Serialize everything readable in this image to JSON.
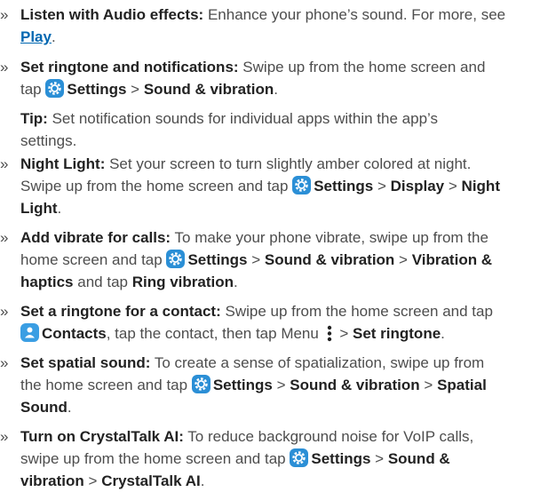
{
  "icons": {
    "settings": "settings-gear-icon",
    "contacts": "contacts-person-icon",
    "menu": "menu-dots-icon"
  },
  "colors": {
    "text": "#4d4d4d",
    "bold": "#222222",
    "link": "#0067b1",
    "icon_bg": "#2b8fd6"
  },
  "items": [
    {
      "head": "Listen with Audio effects:",
      "l1": "Enhance your phone’s sound. For more, see",
      "link": "Play",
      "l2": "."
    },
    {
      "head": "Set ringtone and notifications:",
      "l1": "Swipe up from the home screen and",
      "l2a": "tap",
      "settings": "Settings",
      "sep": ">",
      "sound": "Sound & vibration",
      "end": "."
    },
    {
      "head": "Tip:",
      "l1": "Set notification sounds for individual apps within the app’s",
      "l2": "settings."
    },
    {
      "head": "Night Light:",
      "l1": "Set your screen to turn slightly amber colored at night.",
      "l2a": "Swipe up from the home screen and tap",
      "settings": "Settings",
      "sep1": ">",
      "display": "Display",
      "sep2": ">",
      "night": "Night",
      "l3": "Light",
      "end": "."
    },
    {
      "head": "Add vibrate for calls:",
      "l1": "To make your phone vibrate, swipe up from the",
      "l2a": "home screen and tap",
      "settings": "Settings",
      "sep1": ">",
      "sound": "Sound & vibration",
      "sep2": ">",
      "vib": "Vibration &",
      "l3a": "haptics",
      "l3b": "and tap",
      "ring": "Ring vibration",
      "end": "."
    },
    {
      "head": "Set a ringtone for a contact:",
      "l1": "Swipe up from the home screen and tap",
      "contacts": "Contacts",
      "l2b": ", tap the contact, then tap Menu",
      "sep": ">",
      "set": "Set ringtone",
      "end": "."
    },
    {
      "head": "Set spatial sound:",
      "l1": "To create a sense of spatialization, swipe up from",
      "l2a": "the home screen and tap",
      "settings": "Settings",
      "sep1": ">",
      "sound": "Sound & vibration",
      "sep2": ">",
      "spatial": "Spatial",
      "l3": "Sound",
      "end": "."
    },
    {
      "head": "Turn on CrystalTalk AI:",
      "l1": "To reduce background noise for VoIP calls,",
      "l2a": "swipe up from the home screen and tap",
      "settings": "Settings",
      "sep1": ">",
      "sound1": "Sound &",
      "l3a": "vibration",
      "sep2": ">",
      "crystal": "CrystalTalk AI",
      "end": "."
    }
  ]
}
